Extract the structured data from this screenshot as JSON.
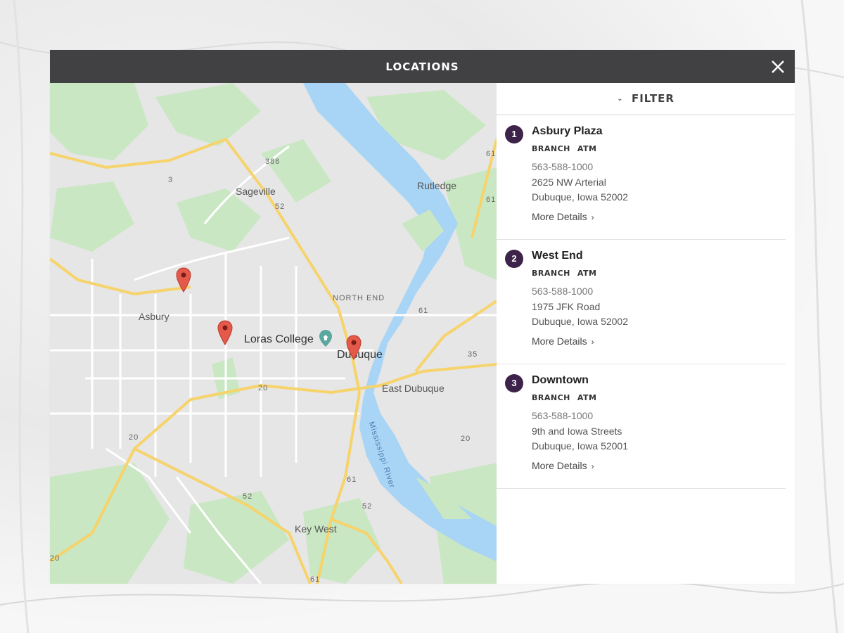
{
  "header": {
    "title": "LOCATIONS",
    "close_icon": "close-icon"
  },
  "filter": {
    "label": "FILTER",
    "icon": "chevron-down-icon"
  },
  "locations": [
    {
      "number": "1",
      "name": "Asbury Plaza",
      "types": [
        "BRANCH",
        "ATM"
      ],
      "phone": "563-588-1000",
      "address_line1": "2625 NW Arterial",
      "address_line2": "Dubuque, Iowa 52002",
      "more": "More Details"
    },
    {
      "number": "2",
      "name": "West End",
      "types": [
        "BRANCH",
        "ATM"
      ],
      "phone": "563-588-1000",
      "address_line1": "1975 JFK Road",
      "address_line2": "Dubuque, Iowa 52002",
      "more": "More Details"
    },
    {
      "number": "3",
      "name": "Downtown",
      "types": [
        "BRANCH",
        "ATM"
      ],
      "phone": "563-588-1000",
      "address_line1": "9th and Iowa Streets",
      "address_line2": "Dubuque, Iowa 52001",
      "more": "More Details"
    }
  ],
  "map": {
    "labels": {
      "sageville": "Sageville",
      "rutledge": "Rutledge",
      "asbury": "Asbury",
      "north_end": "NORTH END",
      "loras": "Loras College",
      "dubuque": "Dubuque",
      "east_dubuque": "East Dubuque",
      "key_west": "Key West",
      "river": "Mississippi River"
    },
    "shields": {
      "r3": "3",
      "r386": "386",
      "r52a": "52",
      "r61a": "61",
      "r35": "35",
      "r20a": "20",
      "r20b": "20",
      "r20c": "20",
      "r61b": "61",
      "r52b": "52",
      "r52c": "52",
      "r61c": "61",
      "r20d": "20",
      "r61d": "61",
      "r61e": "61"
    },
    "colors": {
      "water": "#a8d4f5",
      "land": "#e8e8e8",
      "park": "#c7e8c4",
      "highway": "#f6d36b",
      "road": "#ffffff",
      "pin": "#e5594a"
    }
  }
}
